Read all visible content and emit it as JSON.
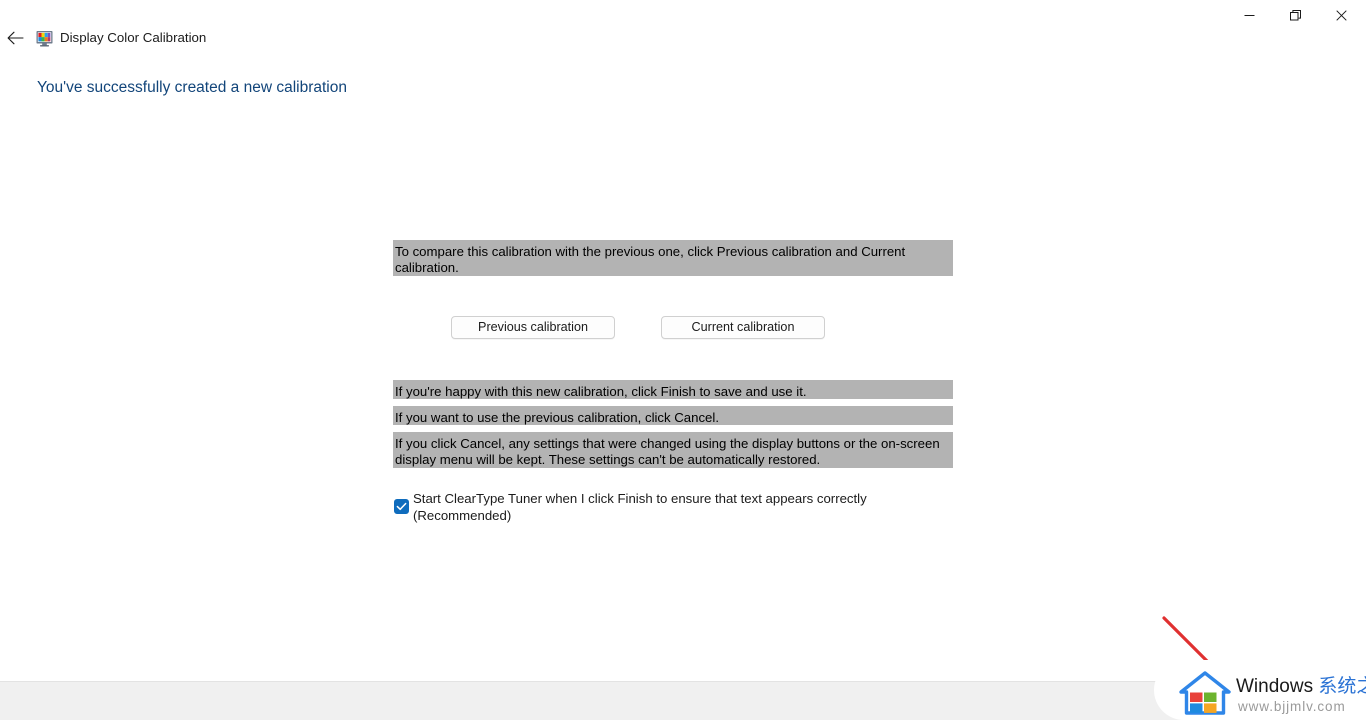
{
  "window": {
    "title": "Display Color Calibration",
    "app_icon": "monitor-color-icon",
    "back_label": "Back",
    "controls": {
      "minimize": "Minimize",
      "maximize": "Restore",
      "close": "Close"
    }
  },
  "page": {
    "heading": "You've successfully created a new calibration",
    "heading_color": "#12457a"
  },
  "instructions": {
    "compare": "To compare this calibration with the previous one, click Previous calibration and Current calibration.",
    "finish": "If you're happy with this new calibration, click Finish to save and use it.",
    "cancel": "If you want to use the previous calibration, click Cancel.",
    "warning": "If you click Cancel, any settings that were changed using the display buttons or the on-screen display menu will be kept. These settings can't be automatically restored.",
    "highlight_color": "#b3b3b3"
  },
  "buttons": {
    "previous_calibration": "Previous calibration",
    "current_calibration": "Current calibration"
  },
  "checkbox": {
    "label": "Start ClearType Tuner when I click Finish to ensure that text appears correctly (Recommended)",
    "checked": true,
    "accent_color": "#0f6cbd"
  },
  "watermark": {
    "brand_en": "Windows ",
    "brand_cn": "系统之家",
    "url": "www.bjjmlv.com",
    "logo": "windows-house-logo",
    "annotation": "red-diagonal-line"
  }
}
